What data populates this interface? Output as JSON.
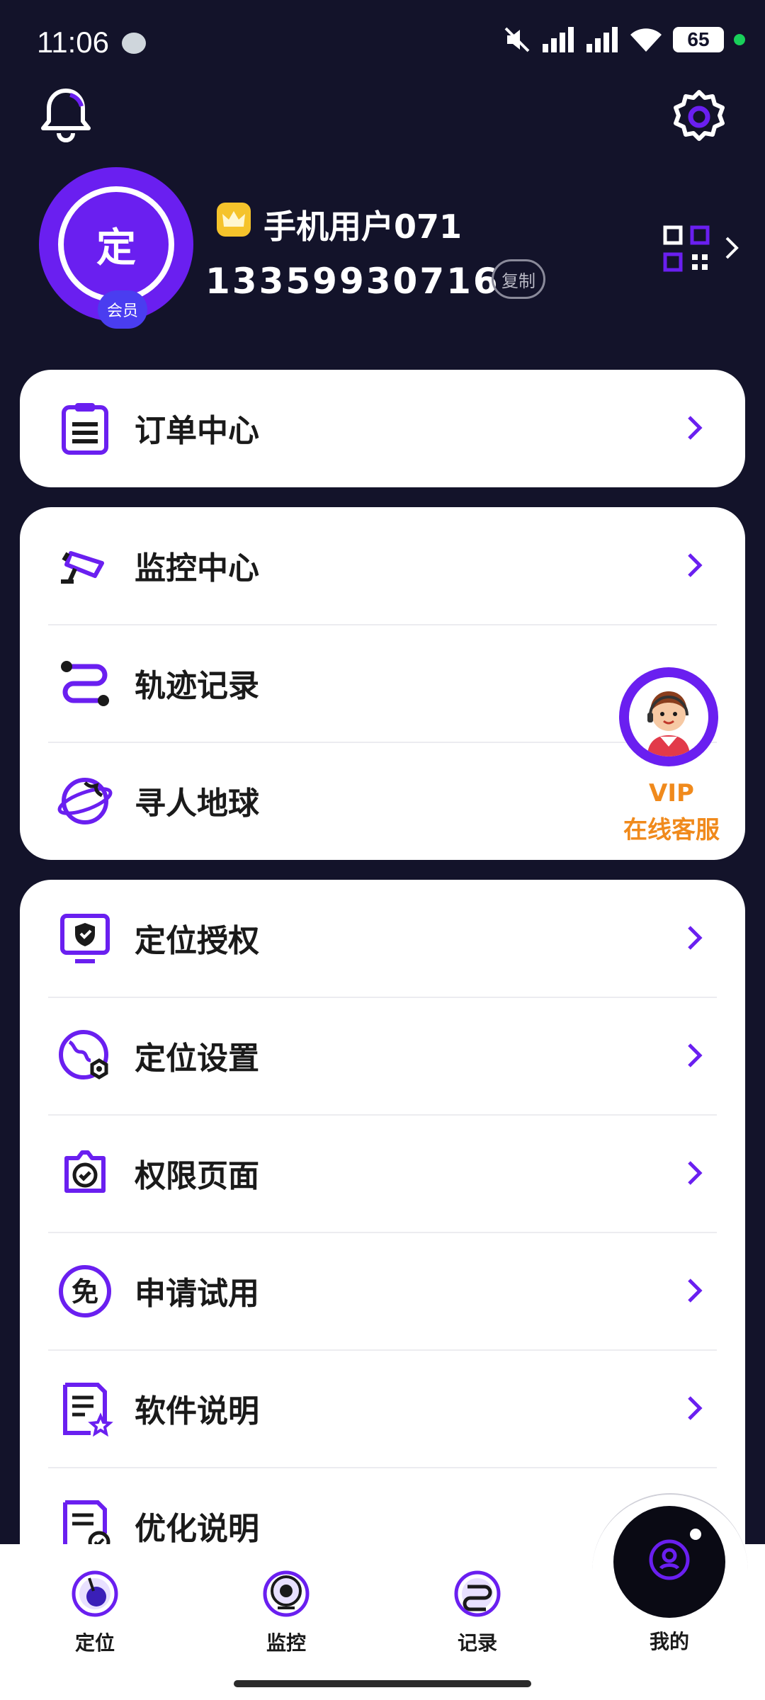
{
  "status_bar": {
    "time": "11:06",
    "battery": "65"
  },
  "profile": {
    "avatar_text": "定",
    "member_badge": "会员",
    "username": "手机用户071",
    "phone": "13359930716",
    "copy_label": "复制"
  },
  "menu_groups": [
    [
      {
        "label": "订单中心",
        "icon": "clipboard-list-icon"
      }
    ],
    [
      {
        "label": "监控中心",
        "icon": "camera-icon"
      },
      {
        "label": "轨迹记录",
        "icon": "route-icon"
      },
      {
        "label": "寻人地球",
        "icon": "globe-icon"
      }
    ],
    [
      {
        "label": "定位授权",
        "icon": "shield-monitor-icon"
      },
      {
        "label": "定位设置",
        "icon": "globe-settings-icon"
      },
      {
        "label": "权限页面",
        "icon": "check-badge-icon"
      },
      {
        "label": "申请试用",
        "icon": "free-badge-icon"
      },
      {
        "label": "软件说明",
        "icon": "document-star-icon"
      },
      {
        "label": "优化说明",
        "icon": "document-check-icon"
      }
    ]
  ],
  "free_icon_char": "免",
  "vip_service": {
    "line1": "VIP",
    "line2": "在线客服"
  },
  "bottom_nav": [
    {
      "label": "定位"
    },
    {
      "label": "监控"
    },
    {
      "label": "记录"
    },
    {
      "label": "我的"
    }
  ],
  "colors": {
    "accent": "#6a1ff0",
    "background": "#13132a",
    "vip": "#f08a1c"
  }
}
